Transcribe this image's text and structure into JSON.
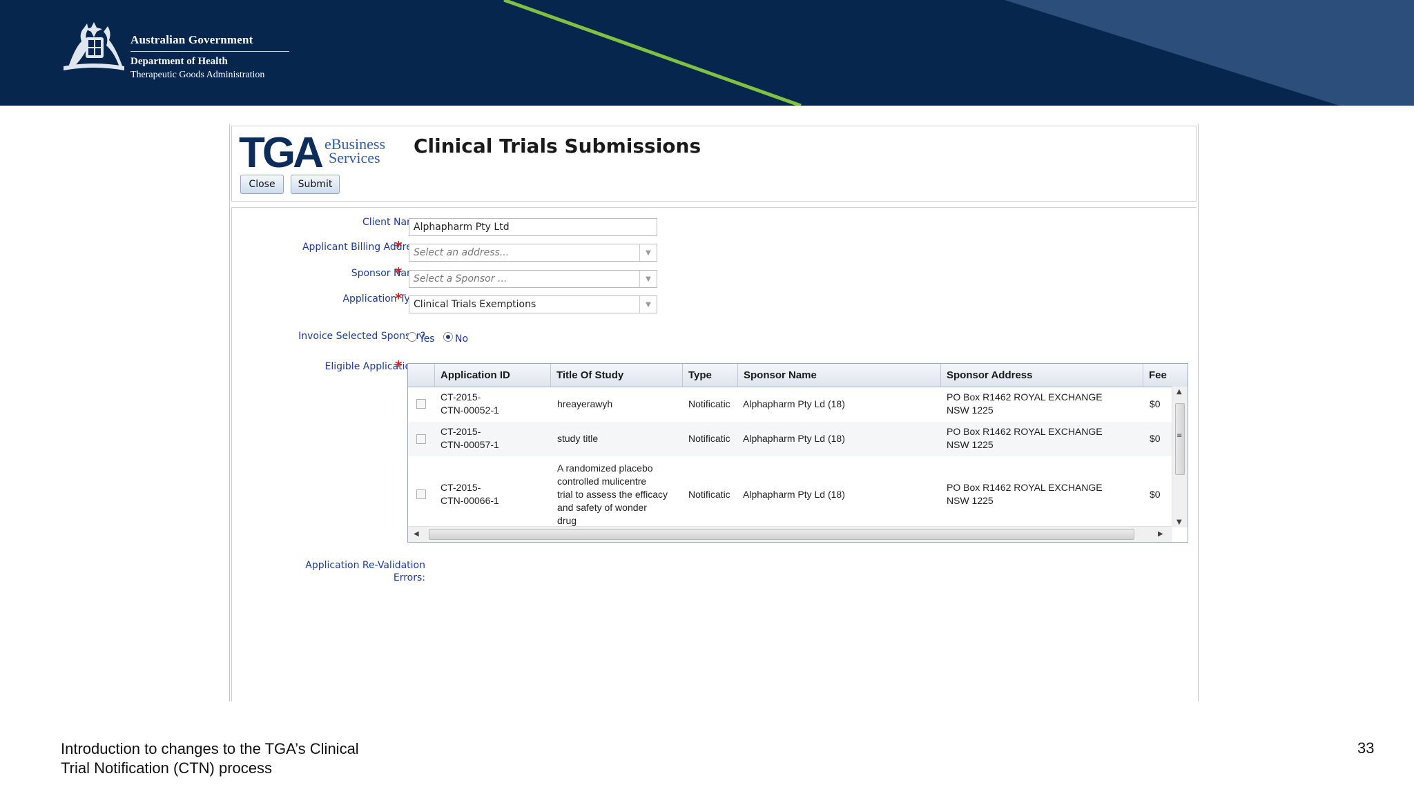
{
  "banner": {
    "gov_line1": "Australian Government",
    "gov_line2": "Department of Health",
    "gov_line3": "Therapeutic Goods Administration",
    "colors": {
      "background": "#06264d",
      "accent_line": "#7fc241",
      "panel": "#2b4f7a"
    }
  },
  "app": {
    "logo_letters": "TGA",
    "logo_ebiz_line1": "eBusiness",
    "logo_ebiz_line2": "Services",
    "title": "Clinical Trials Submissions",
    "buttons": {
      "close": "Close",
      "submit": "Submit"
    }
  },
  "form": {
    "client_name_label": "Client Name:",
    "client_name_value": "Alphapharm Pty Ltd",
    "billing_label": "Applicant Billing Address:",
    "billing_placeholder": "Select an address...",
    "sponsor_label": "Sponsor Name:",
    "sponsor_placeholder": "Select a Sponsor ...",
    "app_type_label": "Application Type:",
    "app_type_value": "Clinical Trials Exemptions",
    "invoice_label": "Invoice Selected Sponsor?",
    "invoice_yes": "Yes",
    "invoice_no": "No",
    "invoice_selected": "No",
    "eligible_label": "Eligible Applications:",
    "revalidation_label_line1": "Application Re-Validation",
    "revalidation_label_line2": "Errors:",
    "required_mark": "*"
  },
  "grid": {
    "columns": [
      "Application ID",
      "Title Of Study",
      "Type",
      "Sponsor Name",
      "Sponsor Address",
      "Fee"
    ],
    "rows": [
      {
        "id_line1": "CT-2015-",
        "id_line2": "CTN-00052-1",
        "title": [
          "hreayerawyh"
        ],
        "type": "Notificatic",
        "sponsor": "Alphapharm Pty Ld (18)",
        "addr_line1": "PO Box R1462 ROYAL EXCHANGE",
        "addr_line2": "NSW 1225",
        "fee": "$0"
      },
      {
        "id_line1": "CT-2015-",
        "id_line2": "CTN-00057-1",
        "title": [
          "study title"
        ],
        "type": "Notificatic",
        "sponsor": "Alphapharm Pty Ld (18)",
        "addr_line1": "PO Box R1462 ROYAL EXCHANGE",
        "addr_line2": "NSW 1225",
        "fee": "$0"
      },
      {
        "id_line1": "CT-2015-",
        "id_line2": "CTN-00066-1",
        "title": [
          "A randomized placebo",
          "controlled mulicentre",
          "trial to assess the efficacy",
          "and safety of wonder",
          "drug"
        ],
        "type": "Notificatic",
        "sponsor": "Alphapharm Pty Ld (18)",
        "addr_line1": "PO Box R1462 ROYAL EXCHANGE",
        "addr_line2": "NSW 1225",
        "fee": "$0"
      }
    ]
  },
  "footer": {
    "line1": "Introduction to changes to the TGA’s Clinical",
    "line2": "Trial Notification (CTN) process",
    "page_number": "33"
  }
}
